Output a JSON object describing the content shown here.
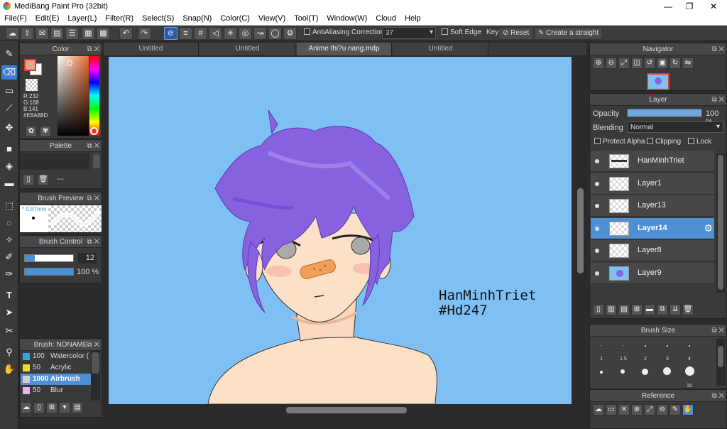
{
  "window": {
    "title": "MediBang Paint Pro (32bit)",
    "minimize": "—",
    "maximize": "❐",
    "close": "✕"
  },
  "menu": [
    "File(F)",
    "Edit(E)",
    "Layer(L)",
    "Filter(R)",
    "Select(S)",
    "Snap(N)",
    "Color(C)",
    "View(V)",
    "Tool(T)",
    "Window(W)",
    "Cloud",
    "Help"
  ],
  "toolbar": {
    "antialiasing": "AntiAliasing",
    "correction_label": "Correction",
    "correction_value": "37",
    "soft_edge": "Soft Edge",
    "key_label": "Key",
    "reset": "Reset",
    "create_straight": "Create a straight"
  },
  "tabs": [
    "Untitled",
    "Untitled",
    "Anime thi?u nang.mdp",
    "Untitled"
  ],
  "color_panel": {
    "title": "Color",
    "r": "R:232",
    "g": "G:168",
    "b": "B:141",
    "hex": "#E8A88D",
    "fg": "#e8a88d",
    "bg": "#ffffff"
  },
  "palette_panel": {
    "title": "Palette",
    "empty": "---"
  },
  "brush_preview": {
    "title": "Brush Preview",
    "size": "0.87mm"
  },
  "brush_control": {
    "title": "Brush Control",
    "size_value": "12",
    "size_fill": 0.2,
    "opacity_value": "100 %",
    "opacity_fill": 1.0
  },
  "brush_list": {
    "title": "Brush: NONAME",
    "items": [
      {
        "size": "100",
        "name": "Watercolor (",
        "color": "#2ea8e0"
      },
      {
        "size": "50",
        "name": "Acrylic",
        "color": "#f0e020"
      },
      {
        "size": "1000",
        "name": "Airbrush",
        "color": "#d0d0d0"
      },
      {
        "size": "50",
        "name": "Blur",
        "color": "#f0b0f0"
      }
    ]
  },
  "canvas": {
    "signature_line1": "HanMinhTriet",
    "signature_line2": "#Hd247",
    "background": "#7ec0f4"
  },
  "navigator": {
    "title": "Navigator"
  },
  "layer_panel": {
    "title": "Layer",
    "opacity_label": "Opacity",
    "opacity_value": "100 %",
    "opacity_fill": 1.0,
    "blending_label": "Blending",
    "blending_value": "Normal",
    "protect_alpha": "Protect Alpha",
    "clipping": "Clipping",
    "lock": "Lock",
    "layers": [
      {
        "name": "HanMinhTriet",
        "selected": false
      },
      {
        "name": "Layer1",
        "selected": false
      },
      {
        "name": "Layer13",
        "selected": false
      },
      {
        "name": "Layer14",
        "selected": true
      },
      {
        "name": "Layer8",
        "selected": false
      },
      {
        "name": "Layer9",
        "selected": false
      }
    ]
  },
  "brush_size_panel": {
    "title": "Brush Size",
    "sizes": [
      "1",
      "1.5",
      "2",
      "3",
      "4",
      "",
      "",
      "",
      "",
      "15"
    ]
  },
  "reference_panel": {
    "title": "Reference"
  }
}
